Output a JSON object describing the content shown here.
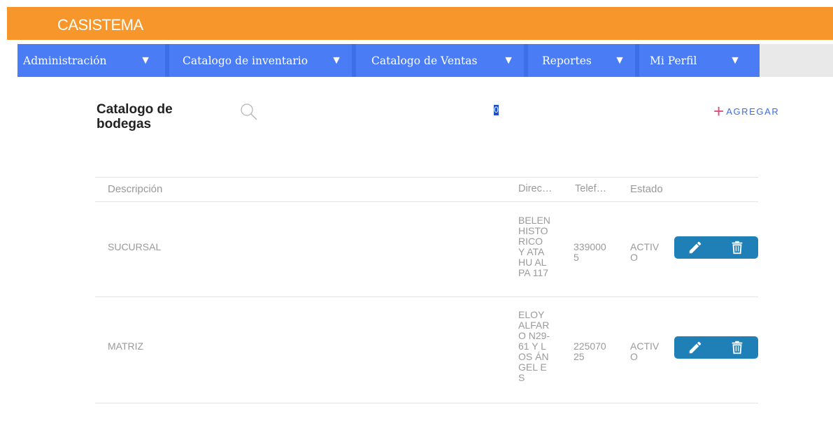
{
  "app": {
    "title": "CASISTEMA"
  },
  "nav": [
    {
      "label": "Administración",
      "arrow": "▼"
    },
    {
      "label": "Catalogo de inventario",
      "arrow": "▼"
    },
    {
      "label": "Catalogo de Ventas",
      "arrow": "▼"
    },
    {
      "label": "Reportes",
      "arrow": "▼"
    },
    {
      "label": "Mi Perfil",
      "arrow": "▼"
    }
  ],
  "page": {
    "title": "Catalogo de bodegas",
    "search_value": "0",
    "add_label": "AGREGAR",
    "add_icon": "+"
  },
  "table": {
    "columns": [
      "Descripción",
      "Direc…",
      "Telef…",
      "Estado"
    ],
    "rows": [
      {
        "descripcion": "SUCURSAL",
        "direccion": "BELEN HISTO RICO Y ATAHU ALPA 117",
        "telefono": "3390005",
        "estado": "ACTIVO"
      },
      {
        "descripcion": "MATRIZ",
        "direccion": "ELOY ALFAR O N29-61 Y LOS ÁNGEL ES",
        "telefono": "22507025",
        "estado": "ACTIVO"
      }
    ]
  },
  "colors": {
    "appbar": "#f7962a",
    "navbar": "#4a7cf6",
    "action": "#1f80b8",
    "add_plus": "#e04a74",
    "add_text": "#3a6ee6"
  }
}
